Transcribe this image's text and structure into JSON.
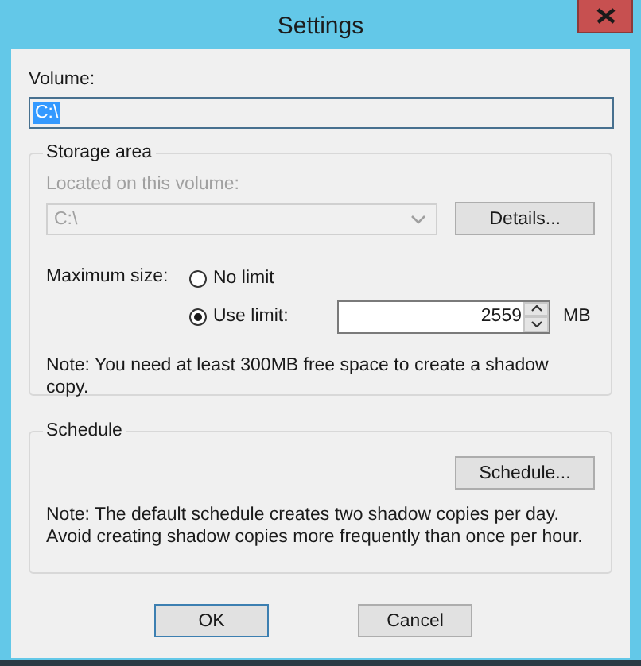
{
  "window": {
    "title": "Settings"
  },
  "volume": {
    "label": "Volume:",
    "value": "C:\\",
    "text_selected": true
  },
  "storage_area": {
    "title": "Storage area",
    "location": {
      "label": "Located on this volume:",
      "value": "C:\\",
      "disabled": true
    },
    "details_button": "Details...",
    "maximum_size": {
      "label": "Maximum size:",
      "options": [
        {
          "label": "No limit",
          "selected": false
        },
        {
          "label": "Use limit:",
          "selected": true
        }
      ],
      "limit": {
        "value": "2559",
        "unit": "MB"
      }
    },
    "note": "Note: You need at least 300MB free space to create a shadow copy."
  },
  "schedule": {
    "title": "Schedule",
    "button": "Schedule...",
    "note": "Note: The default schedule creates two shadow copies per day. Avoid creating shadow copies more frequently than once per hour."
  },
  "buttons": [
    {
      "label": "OK",
      "default": true
    },
    {
      "label": "Cancel",
      "default": false
    }
  ]
}
